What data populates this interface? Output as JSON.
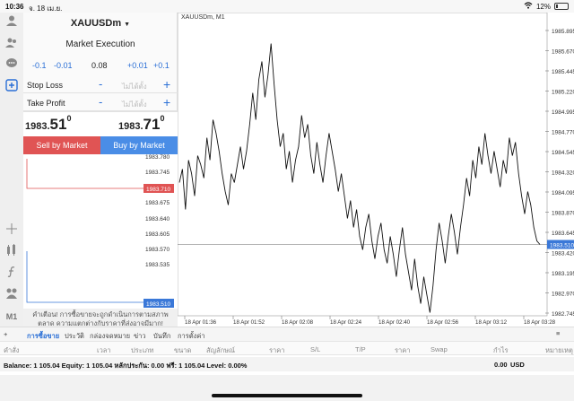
{
  "status": {
    "time": "10:36",
    "date": "จ. 18 เม.ย.",
    "battery": "12%"
  },
  "rail": {
    "timeframe": "M1"
  },
  "order": {
    "symbol": "XAUUSDm",
    "execution": "Market Execution",
    "steps": [
      "-0.1",
      "-0.01",
      "0.08",
      "+0.01",
      "+0.1"
    ],
    "stop_loss_label": "Stop Loss",
    "take_profit_label": "Take Profit",
    "not_set": "ไม่ได้ตั้ง",
    "minus": "-",
    "plus": "+",
    "sell_price_main": "1983.",
    "sell_price_big": "51",
    "sell_price_sup": "0",
    "buy_price_main": "1983.",
    "buy_price_big": "71",
    "buy_price_sup": "0",
    "sell_label": "Sell by Market",
    "buy_label": "Buy by Market",
    "warning": "คำเตือน! การซื้อขายจะถูกดำเนินการตามสภาพตลาด ความแตกต่างกับราคาที่ส่งอาจมีมาก!"
  },
  "mini_chart": {
    "ticks": [
      "1983.780",
      "1983.745",
      "1983.710",
      "1983.675",
      "1983.640",
      "1983.605",
      "1983.570",
      "1983.535",
      "1983.510"
    ],
    "sell_line_label": "1983.710",
    "buy_line_label": "1983.510"
  },
  "chart": {
    "title": "XAUUSDm, M1",
    "y_ticks": [
      "1985.895",
      "1985.670",
      "1985.445",
      "1985.220",
      "1984.995",
      "1984.770",
      "1984.545",
      "1984.320",
      "1984.095",
      "1983.870",
      "1983.645",
      "1983.420",
      "1983.195",
      "1982.970",
      "1982.745"
    ],
    "y_values": [
      1985.895,
      1985.67,
      1985.445,
      1985.22,
      1984.995,
      1984.77,
      1984.545,
      1984.32,
      1984.095,
      1983.87,
      1983.645,
      1983.42,
      1983.195,
      1982.97,
      1982.745
    ],
    "current_price": "1983.510",
    "current_value": 1983.51,
    "x_ticks": [
      "18 Apr 01:36",
      "18 Apr 01:52",
      "18 Apr 02:08",
      "18 Apr 02:24",
      "18 Apr 02:40",
      "18 Apr 02:56",
      "18 Apr 03:12",
      "18 Apr 03:28"
    ],
    "series": [
      1984.2,
      1984.35,
      1983.9,
      1984.45,
      1984.3,
      1984.05,
      1984.5,
      1984.4,
      1984.25,
      1984.7,
      1984.45,
      1984.9,
      1984.75,
      1984.55,
      1984.3,
      1984.1,
      1983.95,
      1984.3,
      1984.2,
      1984.4,
      1984.6,
      1984.35,
      1984.55,
      1984.85,
      1985.2,
      1984.9,
      1985.35,
      1985.55,
      1985.15,
      1985.4,
      1985.75,
      1985.3,
      1984.9,
      1984.6,
      1984.75,
      1984.35,
      1984.55,
      1984.2,
      1984.45,
      1984.6,
      1984.95,
      1984.7,
      1984.85,
      1984.5,
      1984.3,
      1984.65,
      1984.4,
      1984.2,
      1984.5,
      1984.75,
      1984.55,
      1984.35,
      1984.1,
      1984.3,
      1984.05,
      1983.8,
      1984.0,
      1983.7,
      1983.9,
      1983.6,
      1983.45,
      1983.7,
      1983.85,
      1983.55,
      1983.35,
      1983.6,
      1983.75,
      1983.45,
      1983.3,
      1983.6,
      1983.4,
      1983.15,
      1983.45,
      1983.7,
      1983.4,
      1983.2,
      1983.0,
      1983.35,
      1983.05,
      1982.85,
      1983.15,
      1982.95,
      1982.75,
      1983.05,
      1983.45,
      1983.75,
      1983.55,
      1983.3,
      1983.6,
      1983.85,
      1983.65,
      1983.4,
      1983.7,
      1983.95,
      1984.25,
      1984.05,
      1984.45,
      1984.25,
      1984.6,
      1984.4,
      1984.75,
      1984.5,
      1984.3,
      1984.55,
      1984.35,
      1984.15,
      1984.45,
      1984.3,
      1984.7,
      1984.5,
      1984.65,
      1984.3,
      1984.05,
      1983.85,
      1984.1,
      1983.95,
      1983.7,
      1983.55,
      1983.51
    ]
  },
  "tabs": [
    "การซื้อขาย",
    "ประวัติ",
    "กล่องจดหมาย",
    "ข่าว",
    "บันทึก",
    "การตั้งค่า"
  ],
  "columns": [
    "คำสั่ง",
    "เวลา",
    "ประเภท",
    "ขนาด",
    "สัญลักษณ์",
    "ราคา",
    "S/L",
    "T/P",
    "ราคา",
    "Swap",
    "กำไร",
    "หมายเหตุ"
  ],
  "balance": {
    "text": "Balance: 1 105.04 Equity: 1 105.04 หลักประกัน: 0.00 ฟรี: 1 105.04 Level: 0.00%",
    "profit": "0.00",
    "currency": "USD"
  },
  "colors": {
    "accent": "#2a6fd6",
    "sell": "#e05454",
    "buy": "#4a8de6"
  }
}
